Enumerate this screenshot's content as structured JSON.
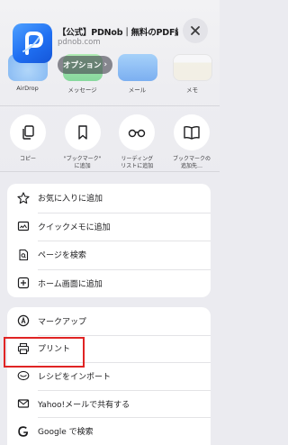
{
  "header": {
    "title": "【公式】PDNob｜無料のPDF編…",
    "url": "pdnob.com",
    "options_label": "オプション",
    "options_chevron": "›"
  },
  "apps": [
    {
      "label": "AirDrop",
      "icon": "airdrop-icon"
    },
    {
      "label": "メッセージ",
      "icon": "messages-icon"
    },
    {
      "label": "メール",
      "icon": "mail-icon"
    },
    {
      "label": "メモ",
      "icon": "notes-icon"
    }
  ],
  "actions": [
    {
      "label": "コピー",
      "icon": "copy-icon"
    },
    {
      "label": "\"ブックマーク\"\nに追加",
      "icon": "bookmark-icon"
    },
    {
      "label": "リーディング\nリストに追加",
      "icon": "glasses-icon"
    },
    {
      "label": "ブックマークの\n追加先…",
      "icon": "book-icon"
    }
  ],
  "group1": [
    {
      "label": "お気に入りに追加",
      "icon": "star-icon"
    },
    {
      "label": "クイックメモに追加",
      "icon": "quick-note-icon"
    },
    {
      "label": "ページを検索",
      "icon": "find-page-icon"
    },
    {
      "label": "ホーム画面に追加",
      "icon": "add-square-icon"
    }
  ],
  "group2": [
    {
      "label": "マークアップ",
      "icon": "markup-icon"
    },
    {
      "label": "プリント",
      "icon": "printer-icon"
    },
    {
      "label": "レシピをインポート",
      "icon": "recipe-icon"
    },
    {
      "label": "Yahoo!メールで共有する",
      "icon": "envelope-icon"
    },
    {
      "label": "Google で検索",
      "icon": "google-icon"
    }
  ],
  "colors": {
    "highlight": "#e02424",
    "app_icon": "#1f6ff2"
  }
}
